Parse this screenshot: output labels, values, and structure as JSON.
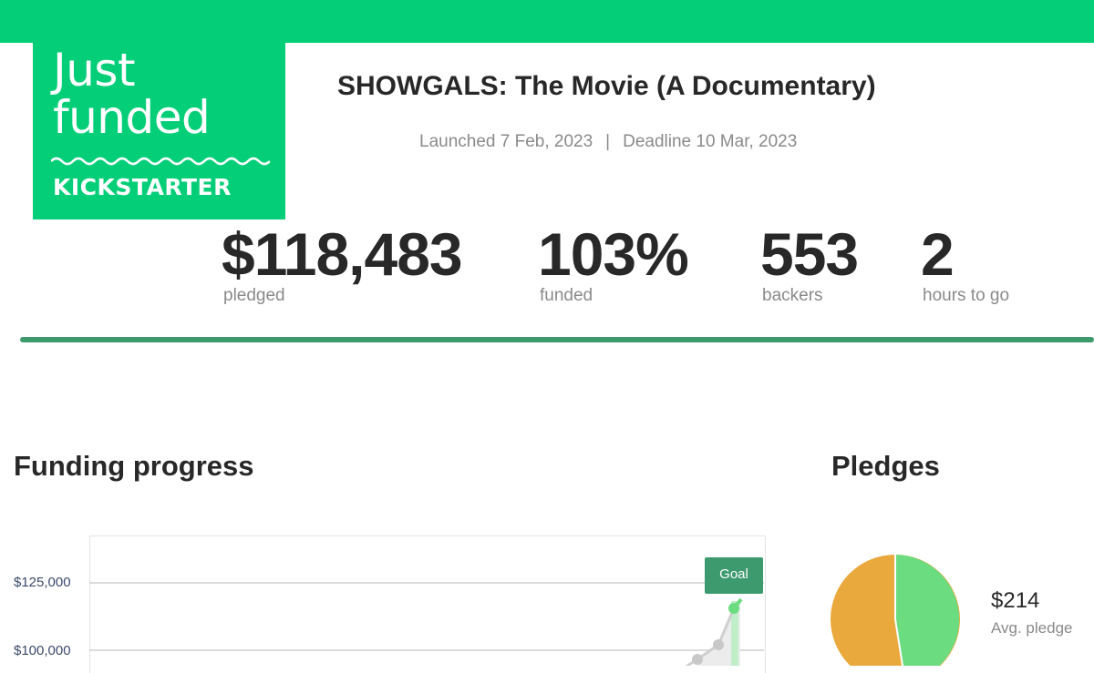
{
  "badge": {
    "line1": "Just",
    "line2": "funded",
    "brand": "KICKSTARTER"
  },
  "project": {
    "title": "SHOWGALS: The Movie (A Documentary)",
    "launched": "Launched 7 Feb, 2023",
    "separator": "|",
    "deadline": "Deadline 10 Mar, 2023"
  },
  "stats": [
    {
      "value": "$118,483",
      "label": "pledged"
    },
    {
      "value": "103%",
      "label": "funded"
    },
    {
      "value": "553",
      "label": "backers"
    },
    {
      "value": "2",
      "label": "hours to go"
    }
  ],
  "funding": {
    "title": "Funding progress",
    "goal_label": "Goal",
    "y_ticks": [
      "$125,000",
      "$100,000"
    ]
  },
  "pledges": {
    "title": "Pledges",
    "avg_value": "$214",
    "avg_label": "Avg. pledge"
  },
  "colors": {
    "brand_green": "#05ce78",
    "divider": "#3d9a6f",
    "pie_orange": "#eaa93d",
    "pie_green": "#6bdc7f"
  }
}
